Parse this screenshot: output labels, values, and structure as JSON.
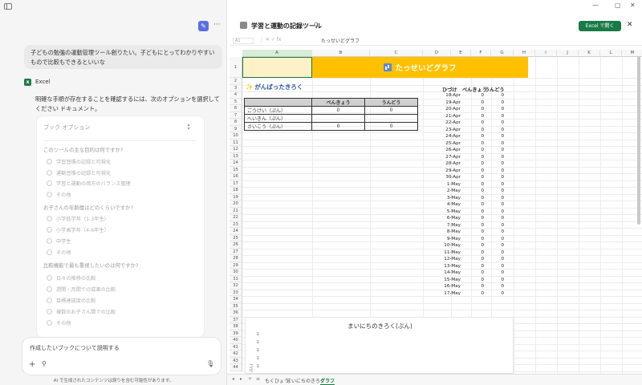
{
  "chat": {
    "user_message": "子どもの勉強の運動管理ツール創りたい。子どもにとってわかりやすいもので比較もできるといいな",
    "assistant_name": "Excel",
    "assistant_message": "明確な手順が存在することを確認するには、次のオプションを選択してください ドキュメント。",
    "options_title": "ブック オプション",
    "questions": [
      {
        "q": "このツールの主な目的は何ですか?",
        "options": [
          "学習習慣の記録と可視化",
          "運動習慣の記録と可視化",
          "学習と運動の両方のバランス管理",
          "その他"
        ]
      },
      {
        "q": "お子さんの年齢層はどのくらいですか?",
        "options": [
          "小学低学年（1-3年生）",
          "小学高学年（4-6年生）",
          "中学生",
          "その他"
        ]
      },
      {
        "q": "比較機能で最も重視したいのは何ですか?",
        "options": [
          "日々の推移の比較",
          "週間・月間での成果の比較",
          "目標達成度の比較",
          "複数のお子さん間での比較",
          "その他"
        ]
      }
    ],
    "input_placeholder": "作成したいブックについて説明する",
    "disclaimer": "AI で生成されたコンテンツは誤りを含む可能性があります。"
  },
  "workbook": {
    "title": "学習と運動の記録ツール",
    "open_button": "Excel で開く",
    "name_box": "A1",
    "formula_content": "たっせいどグラフ",
    "columns": [
      "A",
      "B",
      "C",
      "D",
      "E",
      "F",
      "G",
      "H",
      "I",
      "J",
      "K",
      "L",
      "M"
    ],
    "banner": "たっせいどグラフ",
    "section_title": "がんばったきろく",
    "exercise_table": {
      "headers": [
        "",
        "べんきょう",
        "うんどう"
      ],
      "rows": [
        [
          "ごうけい（ぷん）",
          "0",
          "0"
        ],
        [
          "へいきん（ぷん）",
          "",
          ""
        ],
        [
          "さいこう（ぷん）",
          "0",
          "0"
        ]
      ]
    },
    "daily_log": {
      "headers": [
        "ひづけ",
        "べんきょう",
        "うんどう"
      ],
      "rows": [
        [
          "18-Apr",
          "0",
          "0"
        ],
        [
          "19-Apr",
          "0",
          "0"
        ],
        [
          "20-Apr",
          "0",
          "0"
        ],
        [
          "21-Apr",
          "0",
          "0"
        ],
        [
          "22-Apr",
          "0",
          "0"
        ],
        [
          "23-Apr",
          "0",
          "0"
        ],
        [
          "24-Apr",
          "0",
          "0"
        ],
        [
          "25-Apr",
          "0",
          "0"
        ],
        [
          "26-Apr",
          "0",
          "0"
        ],
        [
          "27-Apr",
          "0",
          "0"
        ],
        [
          "28-Apr",
          "0",
          "0"
        ],
        [
          "29-Apr",
          "0",
          "0"
        ],
        [
          "30-Apr",
          "0",
          "0"
        ],
        [
          "1-May",
          "0",
          "0"
        ],
        [
          "2-May",
          "0",
          "0"
        ],
        [
          "3-May",
          "0",
          "0"
        ],
        [
          "4-May",
          "0",
          "0"
        ],
        [
          "5-May",
          "0",
          "0"
        ],
        [
          "6-May",
          "0",
          "0"
        ],
        [
          "7-May",
          "0",
          "0"
        ],
        [
          "8-May",
          "0",
          "0"
        ],
        [
          "9-May",
          "0",
          "0"
        ],
        [
          "10-May",
          "0",
          "0"
        ],
        [
          "11-May",
          "0",
          "0"
        ],
        [
          "12-May",
          "0",
          "0"
        ],
        [
          "13-May",
          "0",
          "0"
        ],
        [
          "14-May",
          "0",
          "0"
        ],
        [
          "15-May",
          "0",
          "0"
        ],
        [
          "16-May",
          "0",
          "0"
        ],
        [
          "17-May",
          "0",
          "0"
        ]
      ]
    },
    "chart_title": "まいにちのきろく(ぷん)",
    "chart_y_ticks": [
      "1",
      "1",
      "1",
      "1",
      "1"
    ],
    "chart_y_label": "ぷん)",
    "sheet_tabs": [
      "もくひょう",
      "まいにちのきろく",
      "グラフ"
    ],
    "active_tab": "グラフ"
  }
}
